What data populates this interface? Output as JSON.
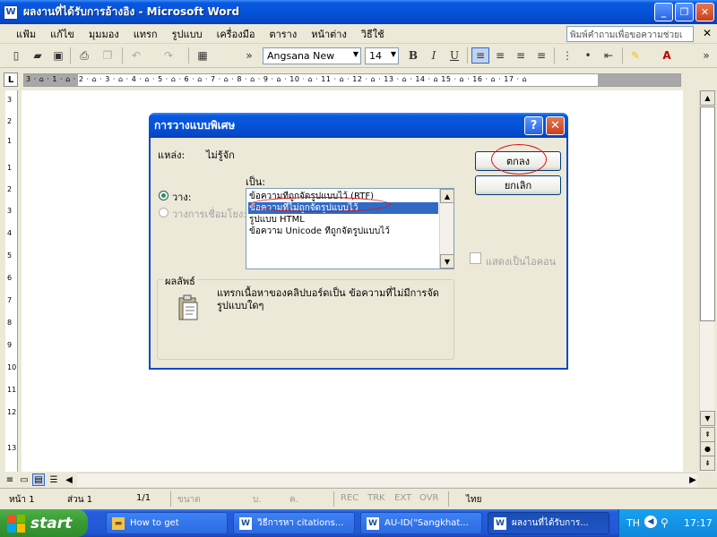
{
  "window": {
    "title": "ผลงานที่ได้รับการอ้างอิง - Microsoft Word",
    "app_icon": "W",
    "min_label": "_",
    "max_label": "❐",
    "close_label": "✕"
  },
  "menubar": {
    "items": [
      "แฟ้ม",
      "แก้ไข",
      "มุมมอง",
      "แทรก",
      "รูปแบบ",
      "เครื่องมือ",
      "ตาราง",
      "หน้าต่าง",
      "วิธีใช้"
    ],
    "help_placeholder": "พิมพ์คำถามเพื่อขอความช่วยเ",
    "close_doc": "✕"
  },
  "toolbar": {
    "font_name": "Angsana New",
    "font_size": "14",
    "bold": "B",
    "italic": "I",
    "underline": "U"
  },
  "ruler": {
    "corner": "L",
    "ticks": "3 · ⌂ · 1 · ⌂ · 2 · ⌂ · 3 · ⌂ · 4 · ⌂ · 5 · ⌂ · 6 · ⌂ · 7 · ⌂ · 8 · ⌂ · 9 · ⌂ · 10 · ⌂ · 11 · ⌂ · 12 · ⌂ · 13 · ⌂ · 14 · ⌂ 15 · ⌂ · 16 · ⌂ · 17 · ⌂",
    "vertical_numbers": [
      "3",
      "2",
      "1",
      "1",
      "2",
      "3",
      "4",
      "5",
      "6",
      "7",
      "8",
      "9",
      "10",
      "11",
      "12",
      "13"
    ]
  },
  "dialog": {
    "title": "การวางแบบพิเศษ",
    "help_label": "?",
    "close_label": "✕",
    "source_label": "แหล่ง:",
    "source_value": "ไม่รู้จัก",
    "as_label": "เป็น:",
    "paste_label": "วาง:",
    "paste_link_label": "วางการเชื่อมโยง:",
    "list_items": [
      "ข้อความที่ถูกจัดรูปแบบไว้ (RTF)",
      "ข้อความที่ไม่ถูกจัดรูปแบบไว้",
      "รูปแบบ HTML",
      "ข้อความ Unicode ที่ถูกจัดรูปแบบไว้"
    ],
    "ok_label": "ตกลง",
    "cancel_label": "ยกเลิก",
    "show_icon_label": "แสดงเป็นไอคอน",
    "result_label": "ผลลัพธ์",
    "result_text": "แทรกเนื้อหาของคลิปบอร์ดเป็น ข้อความที่ไม่มีการจัดรูปแบบใดๆ"
  },
  "statusbar": {
    "page": "หน้า  1",
    "section": "ส่วน  1",
    "page_of": "1/1",
    "at": "ขนาด",
    "ln": "บ.",
    "col": "ค.",
    "rec": "REC",
    "trk": "TRK",
    "ext": "EXT",
    "ovr": "OVR",
    "language": "ไทย"
  },
  "taskbar": {
    "start_label": "start",
    "tasks": [
      {
        "label": "How to get",
        "icon": "folder"
      },
      {
        "label": "วิธีการหา citations...",
        "icon": "W"
      },
      {
        "label": "AU-ID(\"Sangkhat...",
        "icon": "W"
      },
      {
        "label": "ผลงานที่ได้รับการ...",
        "icon": "W"
      }
    ],
    "lang": "TH",
    "clock": "17:17"
  },
  "colors": {
    "xp_blue": "#0553d8",
    "selection": "#316ac5",
    "annotation_red": "#e01010"
  }
}
